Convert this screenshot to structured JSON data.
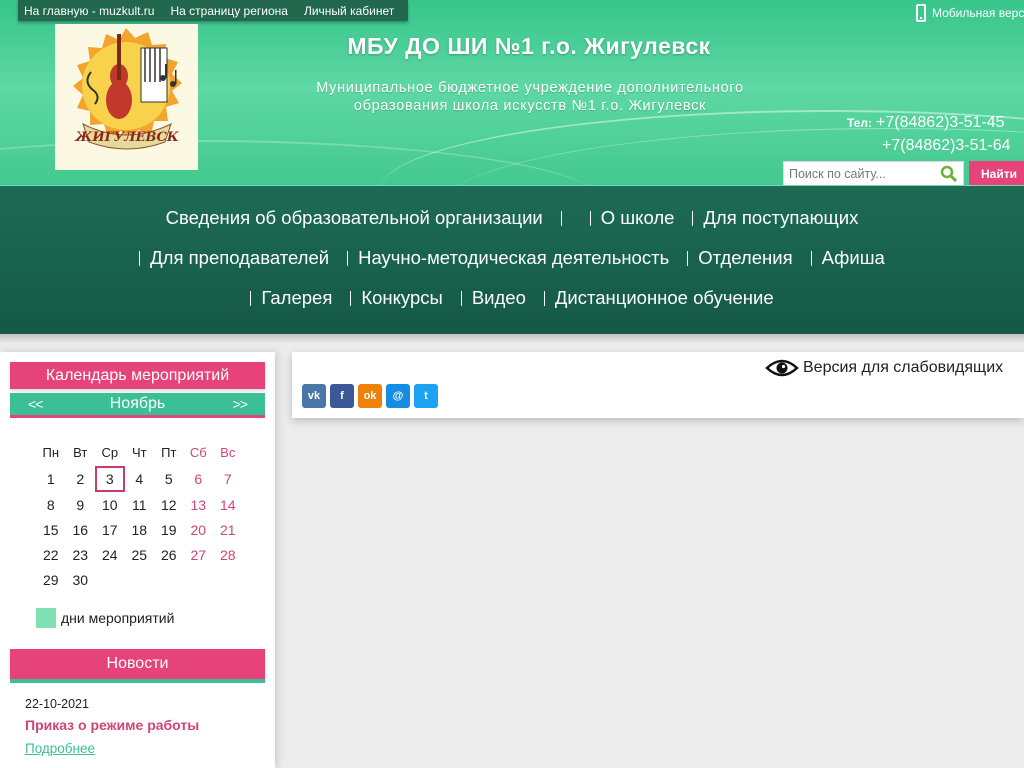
{
  "topbar": {
    "links": [
      "На главную - muzkult.ru",
      "На страницу региона",
      "Личный кабинет"
    ]
  },
  "mobile": {
    "label": "Мобильная верс"
  },
  "header": {
    "title": "МБУ ДО ШИ №1 г.о. Жигулевск",
    "subtitle_line1": "Муниципальное бюджетное учреждение дополнительного",
    "subtitle_line2": "образования школа искусств №1 г.о. Жигулевск",
    "tel_label": "Тел:",
    "tel1": "+7(84862)3-51-45",
    "tel2": "+7(84862)3-51-64",
    "logo_text": "ЖИГУЛЕВСК"
  },
  "search": {
    "placeholder": "Поиск по сайту...",
    "button": "Найти"
  },
  "nav": {
    "row1": [
      "Сведения об образовательной организации",
      "",
      "О школе",
      "Для поступающих"
    ],
    "row2": [
      "Для преподавателей",
      "Научно-методическая деятельность",
      "Отделения",
      "Афиша"
    ],
    "row3": [
      "Галерея",
      "Конкурсы",
      "Видео",
      "Дистанционное обучение"
    ]
  },
  "calendar": {
    "title": "Календарь мероприятий",
    "prev": "<<",
    "next": ">>",
    "month": "Ноябрь",
    "weekdays": [
      "Пн",
      "Вт",
      "Ср",
      "Чт",
      "Пт",
      "Сб",
      "Вс"
    ],
    "weeks": [
      [
        "1",
        "2",
        "3",
        "4",
        "5",
        "6",
        "7"
      ],
      [
        "8",
        "9",
        "10",
        "11",
        "12",
        "13",
        "14"
      ],
      [
        "15",
        "16",
        "17",
        "18",
        "19",
        "20",
        "21"
      ],
      [
        "22",
        "23",
        "24",
        "25",
        "26",
        "27",
        "28"
      ],
      [
        "29",
        "30",
        "",
        "",
        "",
        "",
        ""
      ]
    ],
    "today": "3",
    "legend": "дни мероприятий"
  },
  "news": {
    "title": "Новости",
    "date": "22-10-2021",
    "headline": "Приказ о режиме работы",
    "more": "Подробнее"
  },
  "main": {
    "low_vision": "Версия для слабовидящих"
  },
  "social": [
    {
      "icon": "vk-icon",
      "label": "vk",
      "color": "#4a76a8"
    },
    {
      "icon": "facebook-icon",
      "label": "f",
      "color": "#3b5998"
    },
    {
      "icon": "odnoklassniki-icon",
      "label": "ok",
      "color": "#ee8208"
    },
    {
      "icon": "moimir-icon",
      "label": "@",
      "color": "#168de2"
    },
    {
      "icon": "twitter-icon",
      "label": "t",
      "color": "#1da1f2"
    }
  ],
  "colors": {
    "accent_pink": "#e6437a",
    "accent_green": "#3bbf95",
    "nav_green": "#145946"
  }
}
